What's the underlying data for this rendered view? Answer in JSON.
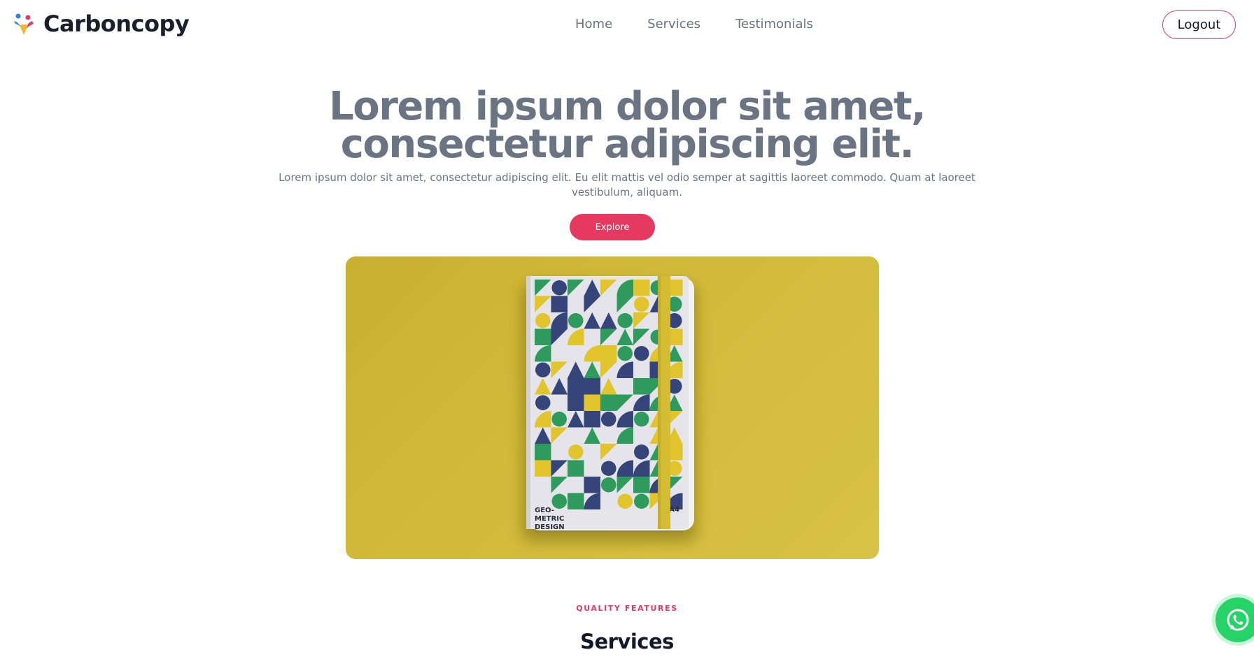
{
  "header": {
    "brand_name": "Carboncopy",
    "nav": [
      {
        "label": "Home"
      },
      {
        "label": "Services"
      },
      {
        "label": "Testimonials"
      }
    ],
    "logout_label": "Logout"
  },
  "hero": {
    "title": "Lorem ipsum dolor sit amet, consectetur adipiscing elit.",
    "subtitle": "Lorem ipsum dolor sit amet, consectetur adipiscing elit. Eu elit mattis vel odio semper at sagittis laoreet commodo. Quam at laoreet vestibulum, aliquam.",
    "cta_label": "Explore",
    "image": {
      "cover_text_left": "GEO-\nMETRIC\nDESIGN",
      "cover_text_right": "A4"
    }
  },
  "features": {
    "eyebrow": "QUALITY FEATURES",
    "title": "Services"
  },
  "colors": {
    "accent": "#e5395f",
    "heading_gray": "#6b7482",
    "image_background": "#cfb837",
    "whatsapp": "#25d366"
  },
  "icons": {
    "brand": "carboncopy-logo-icon",
    "chat": "whatsapp-icon"
  }
}
